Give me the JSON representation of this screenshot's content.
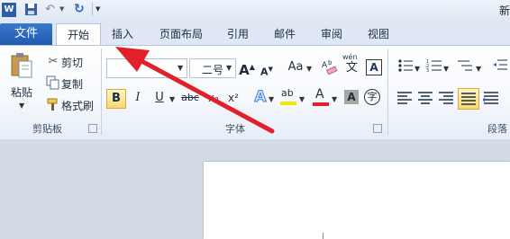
{
  "title_fragment": "新",
  "file_tab": "文件",
  "tabs": [
    "开始",
    "插入",
    "页面布局",
    "引用",
    "邮件",
    "审阅",
    "视图"
  ],
  "clipboard": {
    "paste": "粘贴",
    "cut": "剪切",
    "copy": "复制",
    "format_painter": "格式刷",
    "group_label": "剪贴板"
  },
  "font": {
    "font_name": "",
    "font_size": "二号",
    "group_label": "字体",
    "bold": "B",
    "italic": "I",
    "underline": "U",
    "strikethrough": "abc",
    "subscript": "x₂",
    "superscript": "x²",
    "grow": "A",
    "shrink": "A",
    "change_case": "Aa",
    "phonetic": "wén",
    "highlight": "ab",
    "font_color": "A",
    "char_shading": "A",
    "enclose": "字"
  },
  "paragraph": {
    "group_label": "段落"
  },
  "colors": {
    "file_tab": "#2a65b8",
    "arrow": "#e3202a",
    "font_color_bar": "#e3202a",
    "highlight_bar": "#f7e400"
  }
}
